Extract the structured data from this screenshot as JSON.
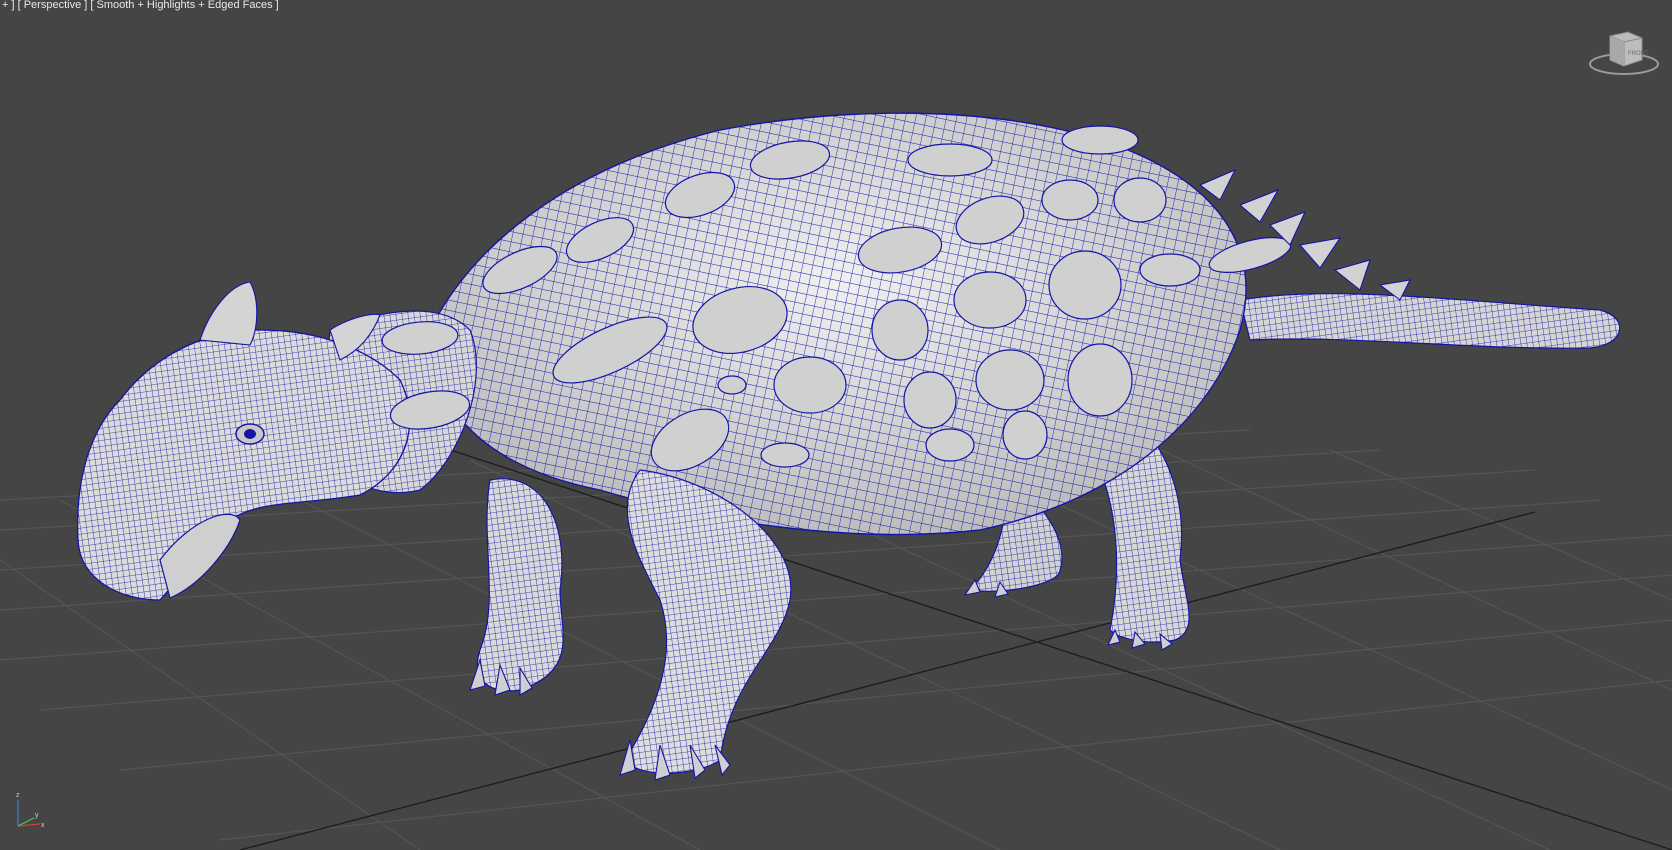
{
  "viewport": {
    "menu_plus": "+",
    "view_label": "Perspective",
    "shading_label": "Smooth + Highlights + Edged Faces"
  },
  "viewcube": {
    "face_label": "FRONT",
    "icon": "viewcube-icon"
  },
  "axis_tripod": {
    "x": "x",
    "y": "y",
    "z": "z",
    "icon": "axis-tripod-icon"
  },
  "colors": {
    "background": "#454545",
    "grid": "#555555",
    "grid_axis": "#111111",
    "mesh_fill": "#dcdcdc",
    "wire": "#1414a8"
  }
}
